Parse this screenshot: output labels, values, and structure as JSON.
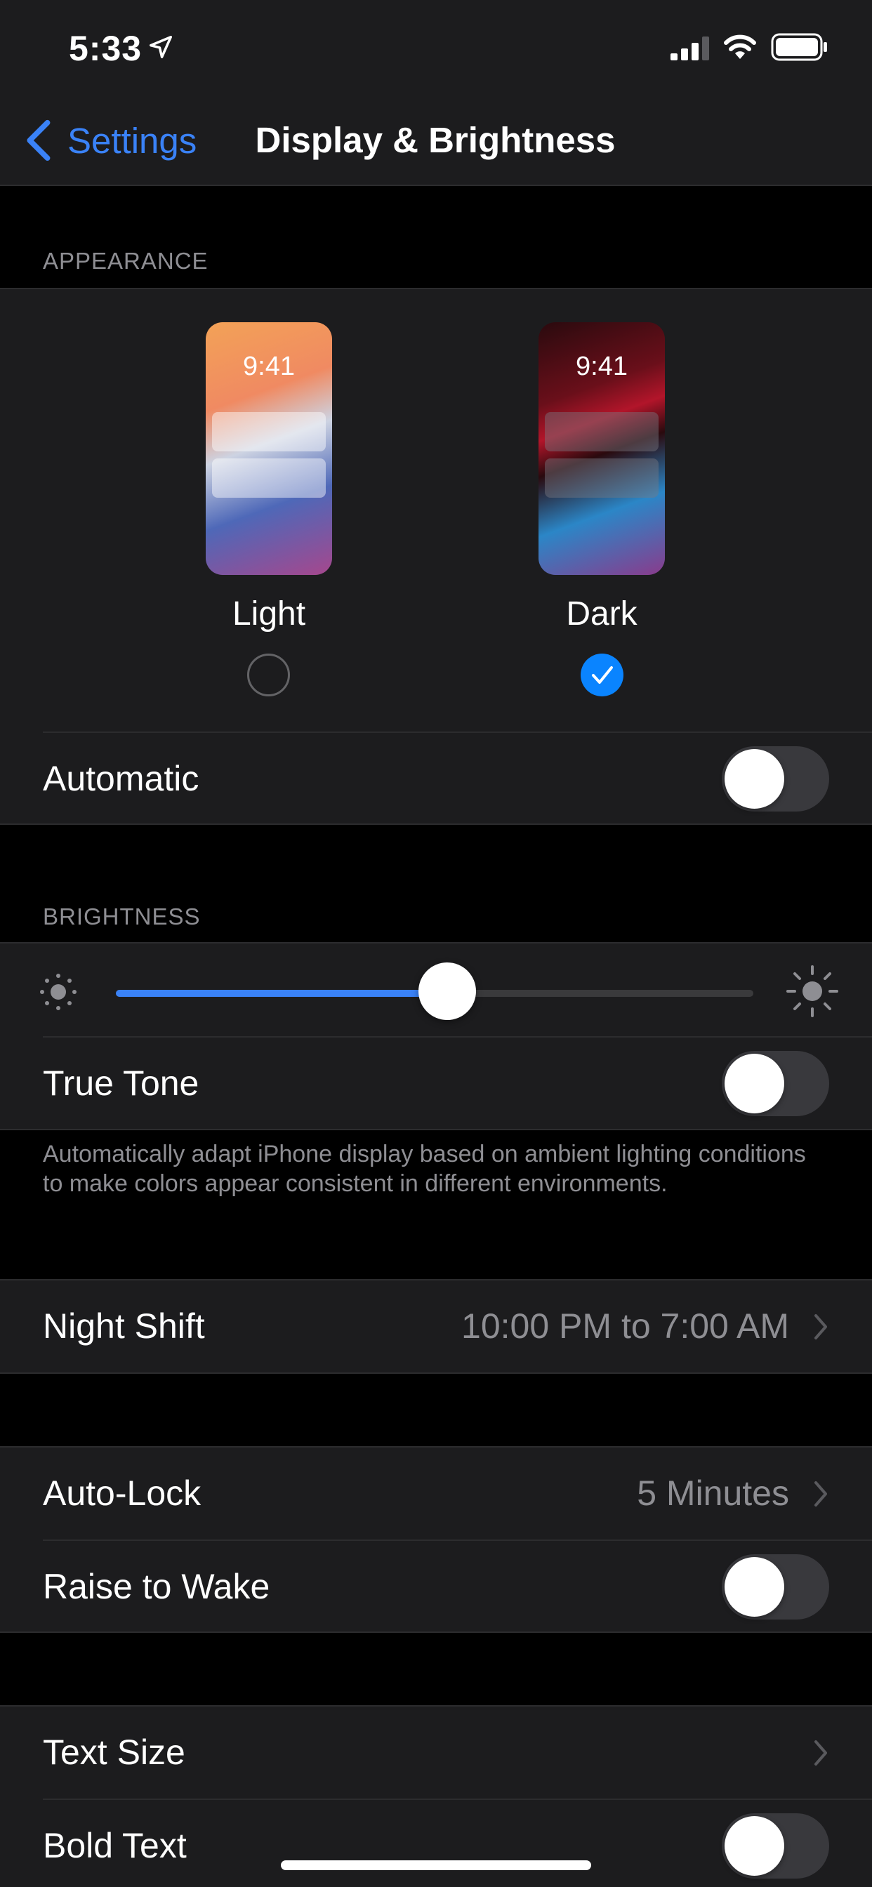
{
  "status_bar": {
    "time": "5:33",
    "icons": [
      "location-arrow-icon",
      "cellular-signal-icon",
      "wifi-icon",
      "battery-icon"
    ]
  },
  "nav": {
    "back_label": "Settings",
    "title": "Display & Brightness"
  },
  "appearance": {
    "header": "APPEARANCE",
    "options": [
      {
        "label": "Light",
        "preview_time": "9:41",
        "selected": false
      },
      {
        "label": "Dark",
        "preview_time": "9:41",
        "selected": true
      }
    ],
    "automatic_label": "Automatic",
    "automatic_on": false
  },
  "brightness": {
    "header": "BRIGHTNESS",
    "level": 0.52,
    "true_tone_label": "True Tone",
    "true_tone_on": false,
    "footnote": "Automatically adapt iPhone display based on ambient lighting conditions to make colors appear consistent in different environments."
  },
  "night_shift": {
    "label": "Night Shift",
    "value": "10:00 PM to 7:00 AM"
  },
  "lock": {
    "auto_lock_label": "Auto-Lock",
    "auto_lock_value": "5 Minutes",
    "raise_to_wake_label": "Raise to Wake",
    "raise_to_wake_on": false
  },
  "text": {
    "text_size_label": "Text Size",
    "bold_text_label": "Bold Text",
    "bold_text_on": false
  },
  "colors": {
    "accent": "#3a82f7",
    "background": "#000000",
    "cell": "#1c1c1e",
    "secondary_text": "#8e8e93"
  }
}
